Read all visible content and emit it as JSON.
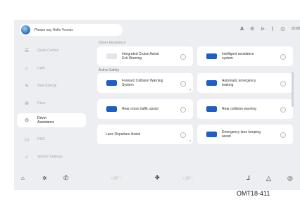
{
  "voice_bar": {
    "text": "Please say Hello Yoomix"
  },
  "status_bar": {
    "icons": [
      "a-icon",
      "gear-icon",
      "signal-icon",
      "bluetooth-icon",
      "clock-icon"
    ],
    "time": "10:08"
  },
  "sidebar": {
    "items": [
      {
        "label": "Quick Control",
        "icon": "sliders-icon"
      },
      {
        "label": "Light",
        "icon": "light-icon"
      },
      {
        "label": "New Energy",
        "icon": "energy-icon"
      },
      {
        "label": "Drive",
        "icon": "steering-wheel-icon"
      },
      {
        "label": "Driver\nAssistance",
        "icon": "driver-assistance-icon",
        "active": true
      },
      {
        "label": "HUD",
        "icon": "hud-icon"
      },
      {
        "label": "Vehicle Settings",
        "icon": "car-icon"
      }
    ]
  },
  "sections": {
    "driver_assistance_label": "Driver Assistance",
    "active_safety_label": "Active Safety"
  },
  "cards": [
    {
      "label": "Integrated Cruise Assist\nExit Warning",
      "state": "off"
    },
    {
      "label": "Intelligent avoidance\nsystem",
      "state": "on"
    },
    {
      "label": "Forward Collision Warning\nSystem",
      "state": "on"
    },
    {
      "label": "Automatic emergency\nbraking",
      "state": "on"
    },
    {
      "label": "Rear cross traffic assist",
      "state": "on"
    },
    {
      "label": "Rear collision warning",
      "state": "on"
    },
    {
      "label": "Lane Departure Assist",
      "state": "none"
    },
    {
      "label": "Emergency lane keeping\nassist",
      "state": "on"
    }
  ],
  "bottom_bar": {
    "left_temp": "‹ 22° ›",
    "right_temp": "‹ 22° ›",
    "icons": [
      "home-icon",
      "apps-icon",
      "phone-icon",
      "fan-icon",
      "seat-icon",
      "navigation-icon",
      "music-icon"
    ]
  },
  "colors": {
    "accent": "#1f5fc4",
    "background": "#eceef1",
    "card": "#ffffff"
  },
  "figure_code": "OMT18-411"
}
